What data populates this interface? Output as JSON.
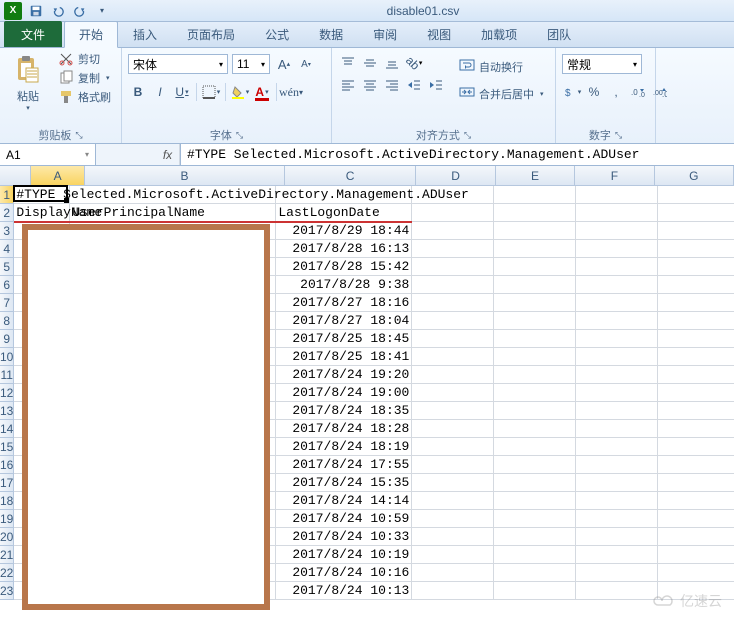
{
  "window": {
    "title": "disable01.csv"
  },
  "tabs": {
    "file": "文件",
    "items": [
      "开始",
      "插入",
      "页面布局",
      "公式",
      "数据",
      "审阅",
      "视图",
      "加载项",
      "团队"
    ],
    "active": 0
  },
  "ribbon": {
    "clipboard": {
      "title": "剪贴板",
      "paste": "粘贴",
      "cut": "剪切",
      "copy": "复制",
      "format_painter": "格式刷"
    },
    "font": {
      "title": "字体",
      "name": "宋体",
      "size": "11",
      "bold": "B",
      "italic": "I",
      "underline": "U",
      "grow": "A",
      "shrink": "A"
    },
    "alignment": {
      "title": "对齐方式",
      "wrap": "自动换行",
      "merge": "合并后居中"
    },
    "number": {
      "title": "数字",
      "format": "常规"
    }
  },
  "namebox": "A1",
  "fx": "fx",
  "formula": "#TYPE Selected.Microsoft.ActiveDirectory.Management.ADUser",
  "columns": [
    "A",
    "B",
    "C",
    "D",
    "E",
    "F",
    "G"
  ],
  "row1": {
    "a": "#TYPE Selected.Microsoft.ActiveDirectory.Management.ADUser"
  },
  "row2": {
    "a": "DisplayName",
    "b": "UserPrincipalName",
    "c": "LastLogonDate"
  },
  "dates": [
    "2017/8/29 18:44",
    "2017/8/28 16:13",
    "2017/8/28 15:42",
    "2017/8/28 9:38",
    "2017/8/27 18:16",
    "2017/8/27 18:04",
    "2017/8/25 18:45",
    "2017/8/25 18:41",
    "2017/8/24 19:20",
    "2017/8/24 19:00",
    "2017/8/24 18:35",
    "2017/8/24 18:28",
    "2017/8/24 18:19",
    "2017/8/24 17:55",
    "2017/8/24 15:35",
    "2017/8/24 14:14",
    "2017/8/24 10:59",
    "2017/8/24 10:33",
    "2017/8/24 10:19",
    "2017/8/24 10:16",
    "2017/8/24 10:13"
  ],
  "watermark": "亿速云"
}
